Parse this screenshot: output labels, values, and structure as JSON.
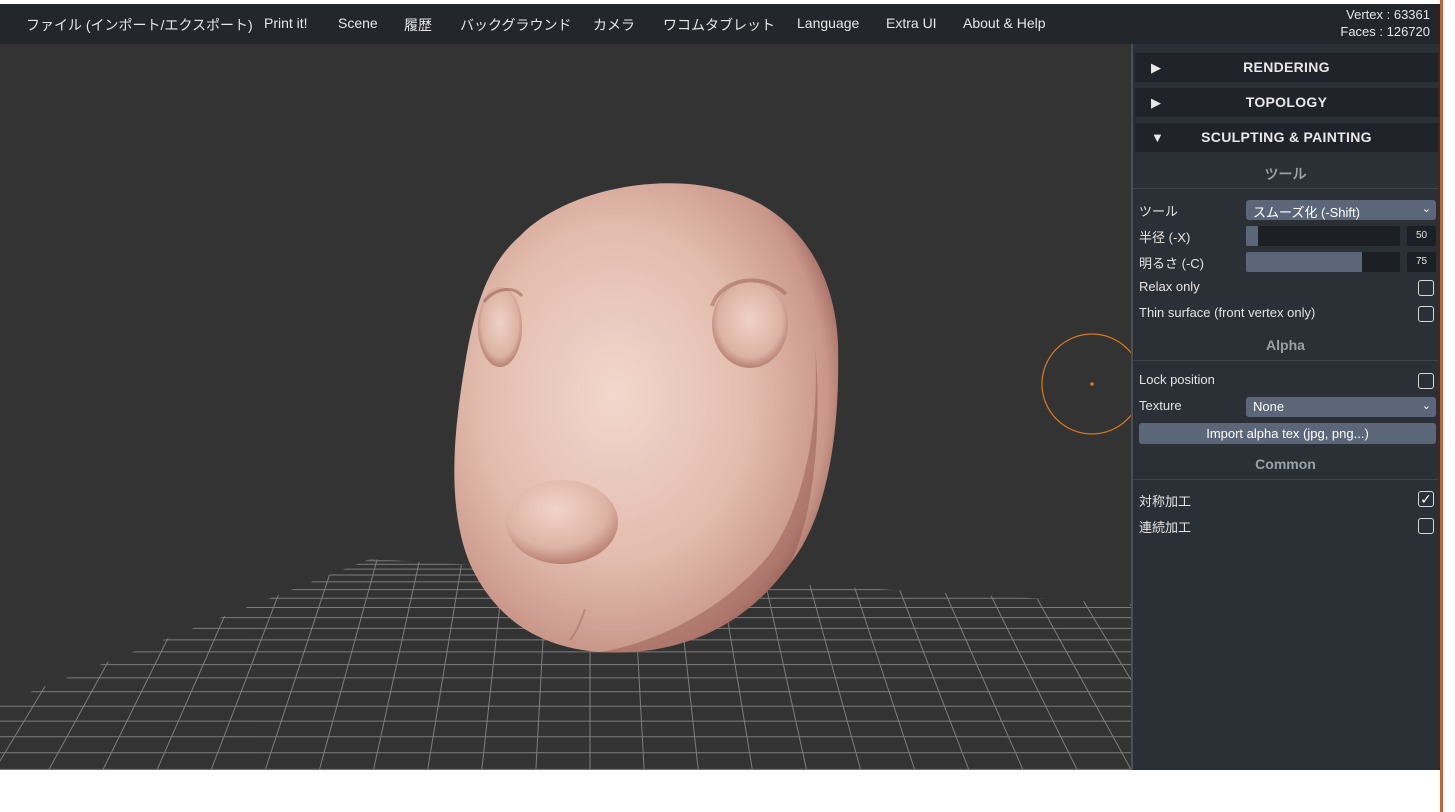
{
  "menubar": {
    "items": [
      {
        "label": "ファイル (インポート/エクスポート)"
      },
      {
        "label": "Print it!"
      },
      {
        "label": "Scene"
      },
      {
        "label": "履歴"
      },
      {
        "label": "バックグラウンド"
      },
      {
        "label": "カメラ"
      },
      {
        "label": "ワコムタブレット"
      },
      {
        "label": "Language"
      },
      {
        "label": "Extra UI"
      },
      {
        "label": "About & Help"
      }
    ],
    "stats": {
      "vertex": "Vertex : 63361",
      "faces": "Faces : 126720"
    }
  },
  "colors": {
    "background": "#333333",
    "menubar": "#23272c",
    "panel": "#2b3037",
    "accent": "#5b6779",
    "cursor_ring": "#d9781e",
    "model_skin": "#e6c1b2"
  },
  "viewport": {
    "model": "sculpted-head-mesh",
    "brush_cursor": "orange-circle-cursor"
  },
  "panel": {
    "folders": [
      {
        "title": "RENDERING",
        "state": "collapsed",
        "icon": "triangle-right-icon"
      },
      {
        "title": "TOPOLOGY",
        "state": "collapsed",
        "icon": "triangle-right-icon"
      },
      {
        "title": "SCULPTING & PAINTING",
        "state": "expanded",
        "icon": "triangle-down-icon"
      }
    ],
    "tool_section": {
      "title": "ツール",
      "tool_label": "ツール",
      "tool_value": "スムーズ化 (-Shift)",
      "radius_label": "半径 (-X)",
      "radius_value": "50",
      "radius_fraction": 0.08,
      "intensity_label": "明るさ (-C)",
      "intensity_value": "75",
      "intensity_fraction": 0.75,
      "relax_label": "Relax only",
      "relax_checked": false,
      "thin_label": "Thin surface (front vertex only)",
      "thin_checked": false
    },
    "alpha_section": {
      "title": "Alpha",
      "lock_label": "Lock position",
      "lock_checked": false,
      "texture_label": "Texture",
      "texture_value": "None",
      "import_label": "Import alpha tex (jpg, png...)"
    },
    "common_section": {
      "title": "Common",
      "symmetry_label": "対称加工",
      "symmetry_checked": true,
      "continuous_label": "連続加工",
      "continuous_checked": false
    }
  }
}
